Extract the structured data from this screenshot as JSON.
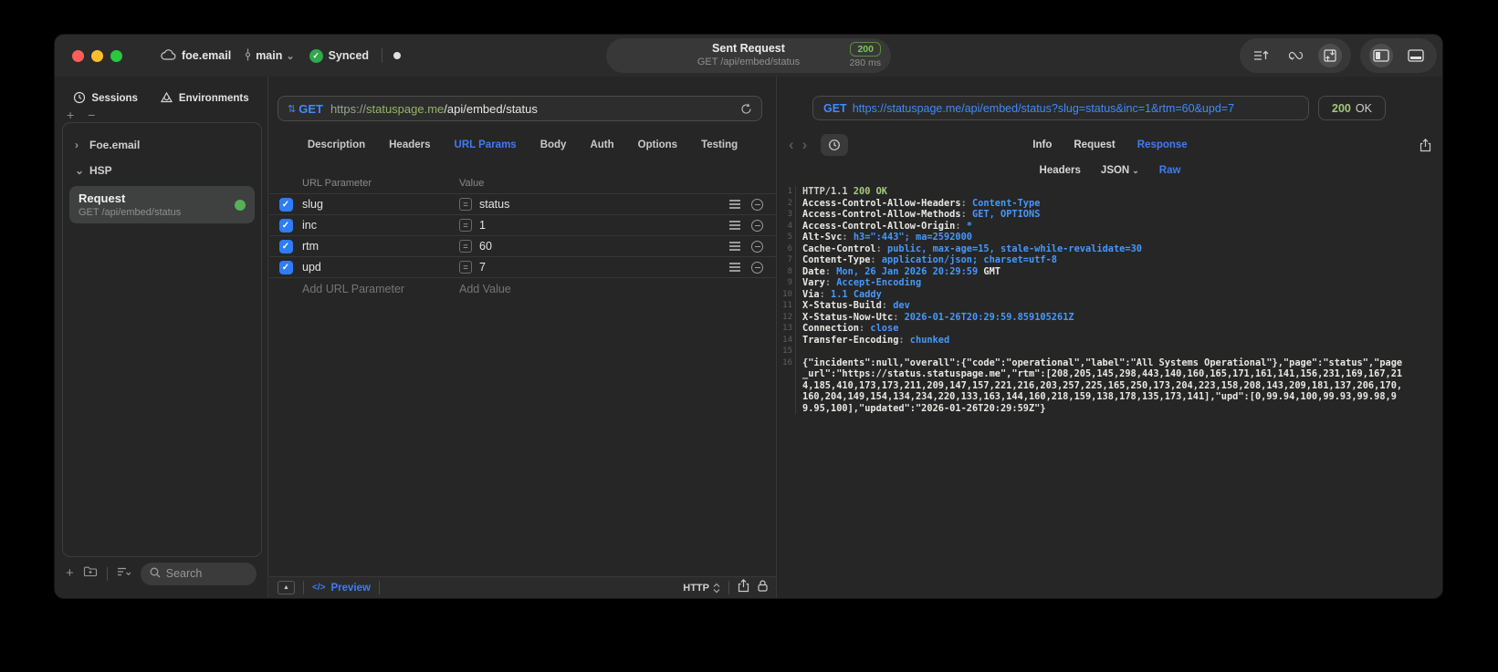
{
  "colors": {
    "accent": "#3E7CF6",
    "code_value_blue": "#4499FF",
    "code_green": "#A6CB7E",
    "host_green": "#95B46A",
    "status_green": "#78c855",
    "checkbox_blue": "#2E7CF6"
  },
  "titlebar": {
    "project": "foe.email",
    "branch": "main",
    "sync": "Synced",
    "center": {
      "title": "Sent Request",
      "subtitle": "GET /api/embed/status",
      "status": "200",
      "time": "280 ms"
    }
  },
  "sidebar": {
    "tabs": [
      {
        "label": "Sessions"
      },
      {
        "label": "Environments"
      }
    ],
    "tree": [
      {
        "label": "Foe.email",
        "chevron": "›"
      },
      {
        "label": "HSP",
        "chevron": "⌄"
      },
      {
        "title": "Request",
        "subtitle": "GET /api/embed/status",
        "selected": true
      }
    ],
    "search_placeholder": "Search"
  },
  "request_pane": {
    "method": "GET",
    "url": {
      "scheme": "https://",
      "host": "statuspage.me",
      "path": "/api/embed/status"
    },
    "tabs": [
      "Description",
      "Headers",
      "URL Params",
      "Body",
      "Auth",
      "Options",
      "Testing"
    ],
    "active_tab": "URL Params",
    "table": {
      "col1": "URL Parameter",
      "col2": "Value",
      "rows": [
        {
          "name": "slug",
          "value": "status",
          "checked": true
        },
        {
          "name": "inc",
          "value": "1",
          "checked": true
        },
        {
          "name": "rtm",
          "value": "60",
          "checked": true
        },
        {
          "name": "upd",
          "value": "7",
          "checked": true
        }
      ],
      "add_name": "Add URL Parameter",
      "add_value": "Add Value"
    },
    "footer": {
      "preview": "Preview",
      "protocol": "HTTP"
    }
  },
  "response_pane": {
    "method": "GET",
    "url": "https://statuspage.me/api/embed/status?slug=status&inc=1&rtm=60&upd=7",
    "status_code": "200",
    "status_text": "OK",
    "tabs": [
      "Info",
      "Request",
      "Response"
    ],
    "active_tab": "Response",
    "subtabs": [
      "Headers",
      "JSON",
      "Raw"
    ],
    "active_subtab": "Raw",
    "body": {
      "lines": [
        {
          "num": 1,
          "segments": [
            {
              "text": "HTTP/1.1 ",
              "style": "plain"
            },
            {
              "text": "200 OK",
              "style": "green"
            }
          ]
        },
        {
          "num": 2,
          "key": "Access-Control-Allow-Headers",
          "value": "Content-Type"
        },
        {
          "num": 3,
          "key": "Access-Control-Allow-Methods",
          "value": "GET, OPTIONS"
        },
        {
          "num": 4,
          "key": "Access-Control-Allow-Origin",
          "value": "*"
        },
        {
          "num": 5,
          "key": "Alt-Svc",
          "value": "h3=\":443\"; ma=2592000"
        },
        {
          "num": 6,
          "key": "Cache-Control",
          "value": "public, max-age=15, stale-while-revalidate=30"
        },
        {
          "num": 7,
          "key": "Content-Type",
          "value": "application/json; charset=utf-8"
        },
        {
          "num": 8,
          "key": "Date",
          "value": "Mon, 26 Jan 2026 20:29:59",
          "suffix": " GMT"
        },
        {
          "num": 9,
          "key": "Vary",
          "value": "Accept-Encoding"
        },
        {
          "num": 10,
          "key": "Via",
          "value": "1.1 Caddy"
        },
        {
          "num": 11,
          "key": "X-Status-Build",
          "value": "dev"
        },
        {
          "num": 12,
          "key": "X-Status-Now-Utc",
          "value": "2026-01-26T20:29:59.859105261Z"
        },
        {
          "num": 13,
          "key": "Connection",
          "value": "close"
        },
        {
          "num": 14,
          "key": "Transfer-Encoding",
          "value": "chunked"
        },
        {
          "num": 15,
          "blank": true
        },
        {
          "num": 16,
          "json": "{\"incidents\":null,\"overall\":{\"code\":\"operational\",\"label\":\"All Systems Operational\"},\"page\":\"status\",\"page_url\":\"https://status.statuspage.me\",\"rtm\":[208,205,145,298,443,140,160,165,171,161,141,156,231,169,167,214,185,410,173,173,211,209,147,157,221,216,203,257,225,165,250,173,204,223,158,208,143,209,181,137,206,170,160,204,149,154,134,234,220,133,163,144,160,218,159,138,178,135,173,141],\"upd\":[0,99.94,100,99.93,99.98,99.95,100],\"updated\":\"2026-01-26T20:29:59Z\"}"
        }
      ]
    }
  }
}
